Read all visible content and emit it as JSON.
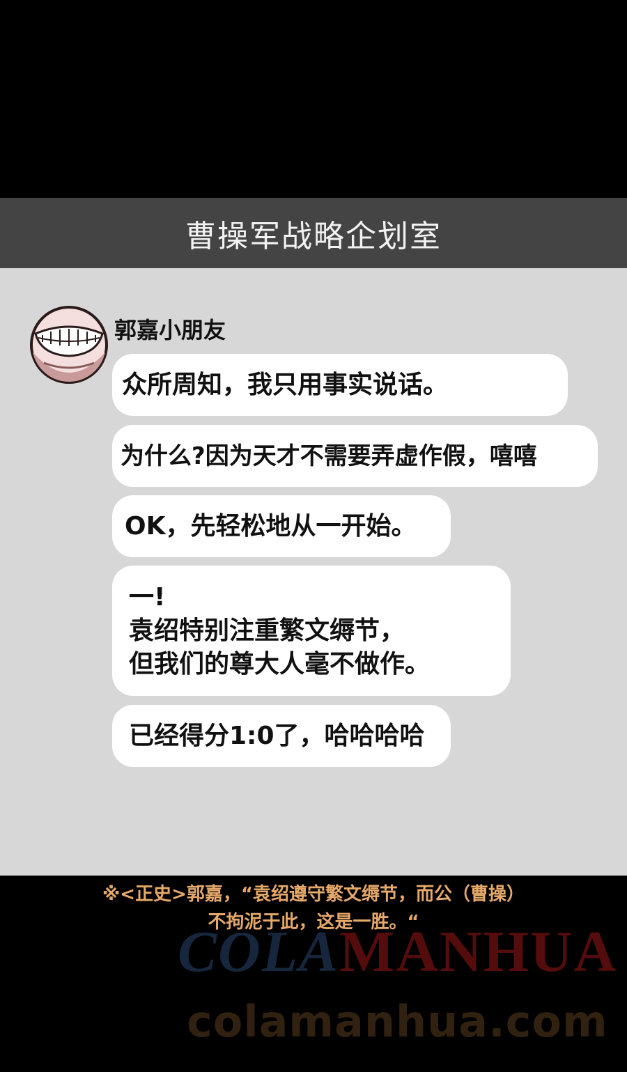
{
  "header": {
    "title": "曹操军战略企划室"
  },
  "sender": {
    "name": "郭嘉小朋友",
    "avatar_icon": "grinning-mouth-avatar"
  },
  "messages": [
    {
      "text": "众所周知，我只用事实说话。"
    },
    {
      "text": "为什么?因为天才不需要弄虚作假，嘻嘻"
    },
    {
      "text": "OK，先轻松地从一开始。"
    },
    {
      "lines": [
        "一!",
        "袁绍特别注重繁文缛节，",
        "但我们的尊大人毫不做作。"
      ]
    },
    {
      "text": "已经得分1:0了，哈哈哈哈"
    }
  ],
  "footnote": {
    "line1": "※<正史>郭嘉，“袁绍遵守繁文缛节，而公（曹操）",
    "line2": "不拘泥于此，这是一胜。“"
  },
  "watermark": {
    "part_a": "COLA",
    "part_b": "MANHUA",
    "url": "colamanhua.com"
  },
  "colors": {
    "header_bg": "#444444",
    "chat_bg": "#d7d7d7",
    "bubble_bg": "#ffffff",
    "footnote_text": "#e6a96a"
  }
}
